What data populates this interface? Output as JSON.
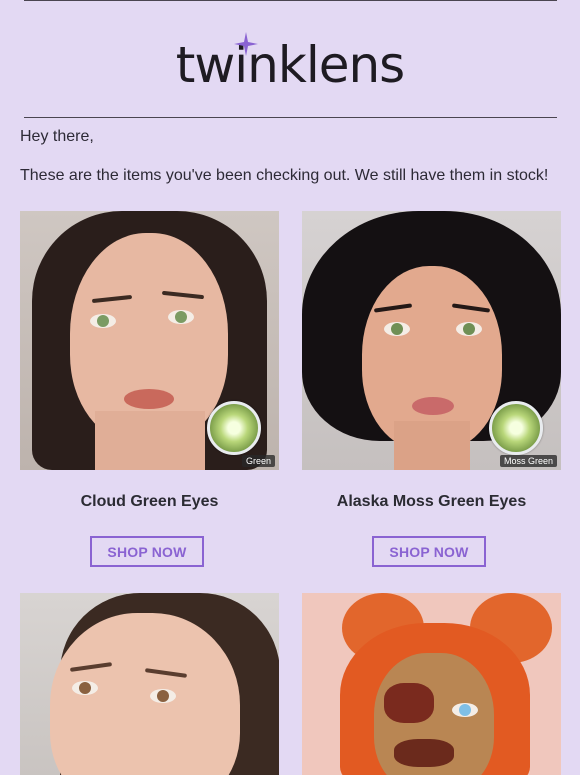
{
  "brand": {
    "logo_text": "twinklens",
    "logo_icon": "sparkle-star-icon",
    "accent": "#8a63d2",
    "background": "#e3d9f3"
  },
  "email": {
    "greeting": "Hey there,",
    "intro": "These are the items you've been checking out. We still have them in stock!"
  },
  "products": [
    {
      "name": "Cloud Green Eyes",
      "lens_label": "Green",
      "button": "SHOP NOW",
      "image": "model-green-eyes-photo"
    },
    {
      "name": "Alaska Moss Green Eyes",
      "lens_label": "Moss Green",
      "button": "SHOP NOW",
      "image": "model-moss-green-eyes-photo"
    },
    {
      "image": "model-brown-eyes-photo"
    },
    {
      "image": "zombie-costume-blue-eyes-photo"
    }
  ]
}
